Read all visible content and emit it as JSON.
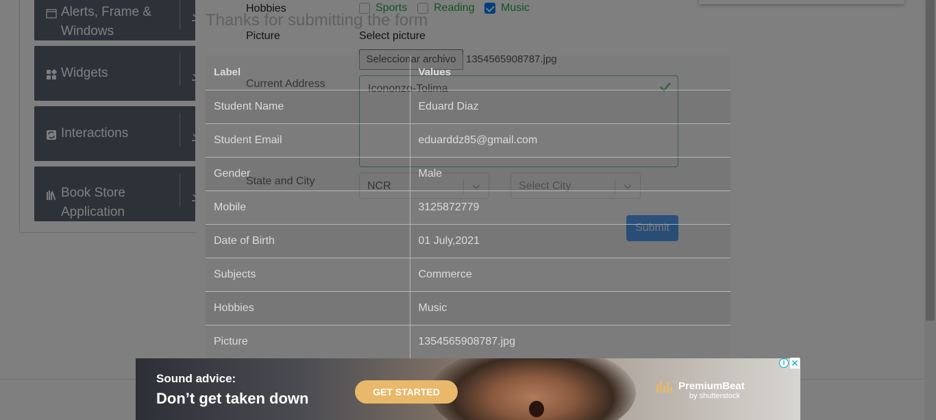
{
  "sidebar": {
    "groups": [
      {
        "label": "Alerts, Frame &\nWindows",
        "icon": "window-icon"
      },
      {
        "label": "Widgets",
        "icon": "widgets-icon"
      },
      {
        "label": "Interactions",
        "icon": "interactions-icon"
      },
      {
        "label": "Book Store\nApplication",
        "icon": "books-icon"
      }
    ]
  },
  "form": {
    "hobbies_label": "Hobbies",
    "hobbies": [
      {
        "label": "Sports",
        "checked": false
      },
      {
        "label": "Reading",
        "checked": false
      },
      {
        "label": "Music",
        "checked": true
      }
    ],
    "picture_label": "Picture",
    "select_picture_label": "Select picture",
    "file_button": "Seleccionar archivo",
    "file_name": "1354565908787.jpg",
    "address_label": "Current Address",
    "address_value": "Icononzo-Tolima",
    "state_city_label": "State and City",
    "state_value": "NCR",
    "city_placeholder": "Select City",
    "submit": "Submit"
  },
  "modal": {
    "title": "Thanks for submitting the form",
    "columns": [
      "Label",
      "Values"
    ],
    "rows": [
      [
        "Student Name",
        "Eduard Diaz"
      ],
      [
        "Student Email",
        "eduarddz85@gmail.com"
      ],
      [
        "Gender",
        "Male"
      ],
      [
        "Mobile",
        "3125872779"
      ],
      [
        "Date of Birth",
        "01 July,2021"
      ],
      [
        "Subjects",
        "Commerce"
      ],
      [
        "Hobbies",
        "Music"
      ],
      [
        "Picture",
        "1354565908787.jpg"
      ]
    ]
  },
  "ad": {
    "line1": "Sound advice:",
    "line2": "Don’t get taken down",
    "cta": "GET STARTED",
    "brand": "PremiumBeat",
    "brand_sub": "by shutterstock",
    "info": "i",
    "close": "✕"
  },
  "colors": {
    "sidebar_group": "#5a6473",
    "accent_blue": "#007bff",
    "valid_green": "#28a745",
    "ad_cta": "#e9b86a",
    "ad_controls": "#00aecd"
  }
}
